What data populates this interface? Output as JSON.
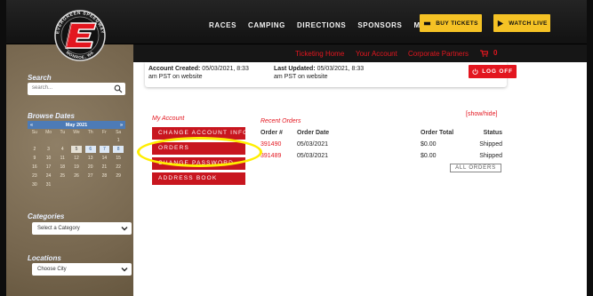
{
  "nav": {
    "links": [
      "RACES",
      "CAMPING",
      "DIRECTIONS",
      "SPONSORS",
      "MERCH"
    ],
    "buy_tickets": "BUY TICKETS",
    "watch_live": "WATCH LIVE",
    "accent": "#f5c225"
  },
  "logo": {
    "letter": "E",
    "ring_top": "EVERGREEN SPEEDWAY",
    "ring_bottom": "MONROE, WA"
  },
  "subnav": {
    "links": [
      "Ticketing Home",
      "Your Account",
      "Corporate Partners"
    ],
    "cart_count": "0",
    "accent": "#e3161f"
  },
  "sidebar": {
    "search_label": "Search",
    "search_placeholder": "search...",
    "browse_label": "Browse Dates",
    "calendar": {
      "month": "May 2021",
      "prev": "«",
      "next": "»",
      "days_of_week": [
        "Su",
        "Mo",
        "Tu",
        "We",
        "Th",
        "Fr",
        "Sa"
      ],
      "weeks": [
        [
          "",
          "",
          "",
          "",
          "",
          "",
          "1"
        ],
        [
          "2",
          "3",
          "4",
          "5",
          "6",
          "7",
          "8"
        ],
        [
          "9",
          "10",
          "11",
          "12",
          "13",
          "14",
          "15"
        ],
        [
          "16",
          "17",
          "18",
          "19",
          "20",
          "21",
          "22"
        ],
        [
          "23",
          "24",
          "25",
          "26",
          "27",
          "28",
          "29"
        ],
        [
          "30",
          "31",
          "",
          "",
          "",
          "",
          ""
        ]
      ],
      "today": "5",
      "event_days": [
        "6",
        "7",
        "8"
      ]
    },
    "categories_label": "Categories",
    "categories_value": "Select a Category",
    "locations_label": "Locations",
    "locations_value": "Choose City"
  },
  "account": {
    "created_label": "Account Created:",
    "created_value": "05/03/2021, 8:33",
    "created_value_2": "am PST on website",
    "updated_label": "Last Updated:",
    "updated_value": "05/03/2021, 8:33",
    "updated_value_2": "am PST on website",
    "logoff_label": "LOG OFF",
    "menu_title": "My Account",
    "menu": [
      "CHANGE ACCOUNT INFORMATION",
      "ORDERS",
      "CHANGE PASSWORD",
      "ADDRESS BOOK"
    ]
  },
  "orders": {
    "title": "Recent Orders",
    "show_hide": "[show/hide]",
    "columns": [
      "Order #",
      "Order Date",
      "Order Total",
      "Status"
    ],
    "rows": [
      {
        "number": "391490",
        "date": "05/03/2021",
        "total": "$0.00",
        "status": "Shipped"
      },
      {
        "number": "391489",
        "date": "05/03/2021",
        "total": "$0.00",
        "status": "Shipped"
      }
    ],
    "all_orders": "ALL ORDERS"
  }
}
